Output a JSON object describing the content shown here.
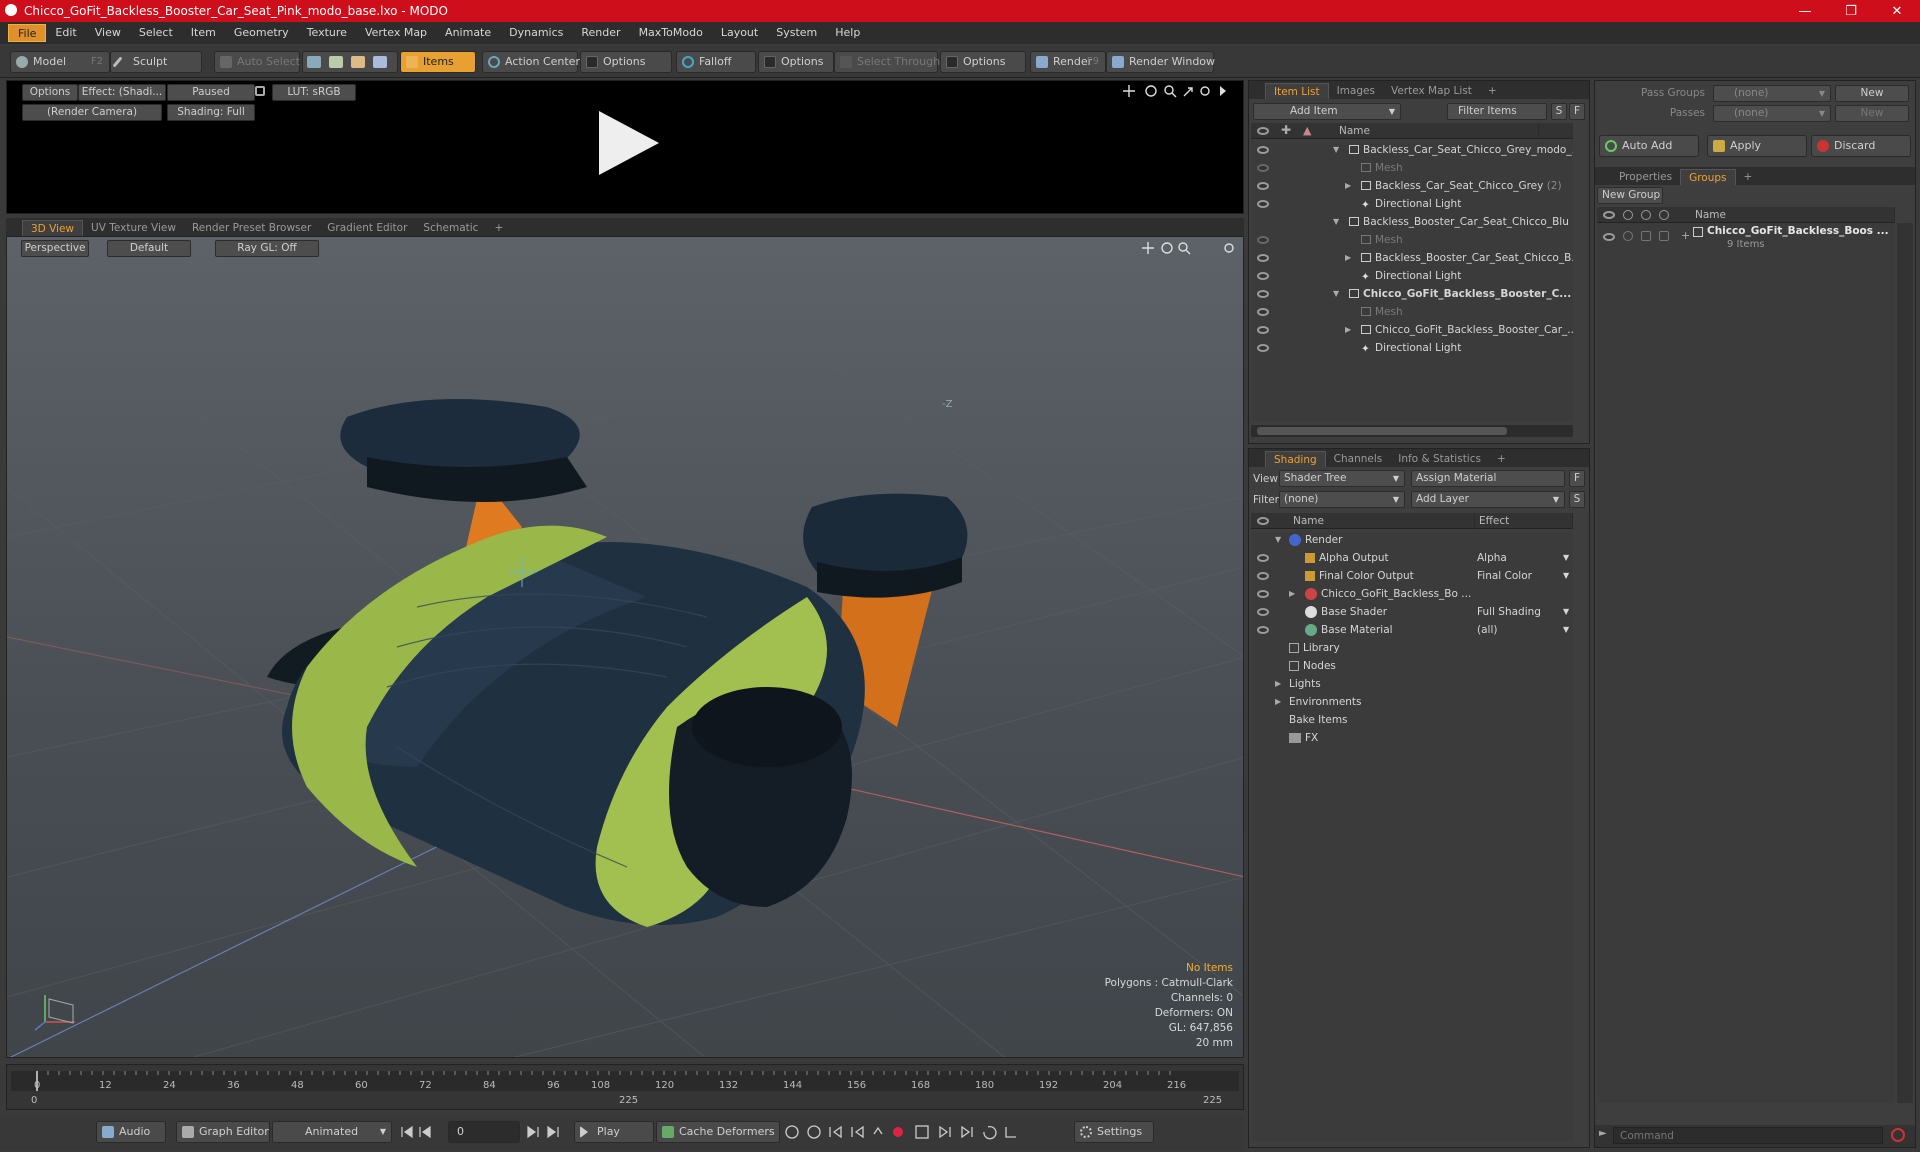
{
  "window": {
    "title": "Chicco_GoFit_Backless_Booster_Car_Seat_Pink_modo_base.lxo - MODO"
  },
  "menu": [
    "File",
    "Edit",
    "View",
    "Select",
    "Item",
    "Geometry",
    "Texture",
    "Vertex Map",
    "Animate",
    "Dynamics",
    "Render",
    "MaxToModo",
    "Layout",
    "System",
    "Help"
  ],
  "toolbar": {
    "model": "Model",
    "model_key": "F2",
    "sculpt": "Sculpt",
    "auto_select": "Auto Select",
    "items": "Items",
    "action_center": "Action Center",
    "options1": "Options",
    "falloff": "Falloff",
    "options2": "Options",
    "select_through": "Select Through",
    "options3": "Options",
    "render": "Render",
    "render_key": "F9",
    "render_window": "Render Window"
  },
  "preview": {
    "options": "Options",
    "effect": "Effect: (Shadi...",
    "paused": "Paused",
    "lut": "LUT: sRGB",
    "camera": "(Render Camera)",
    "shading": "Shading: Full"
  },
  "viewport_tabs": [
    "3D View",
    "UV Texture View",
    "Render Preset Browser",
    "Gradient Editor",
    "Schematic"
  ],
  "viewport": {
    "perspective": "Perspective",
    "default": "Default",
    "raygl": "Ray GL: Off",
    "axis_label": "-Z",
    "info": {
      "no_items": "No Items",
      "polygons": "Polygons : Catmull-Clark",
      "channels": "Channels: 0",
      "deformers": "Deformers: ON",
      "gl": "GL: 647,856",
      "scale": "20 mm"
    }
  },
  "timeline": {
    "ticks": [
      "0",
      "12",
      "24",
      "36",
      "48",
      "60",
      "72",
      "84",
      "96",
      "108",
      "120",
      "132",
      "144",
      "156",
      "168",
      "180",
      "192",
      "204",
      "216"
    ],
    "start": "0",
    "mid": "225",
    "end": "225"
  },
  "bottombar": {
    "audio": "Audio",
    "graph_editor": "Graph Editor",
    "animated": "Animated",
    "frame": "0",
    "play": "Play",
    "cache": "Cache Deformers",
    "settings": "Settings"
  },
  "item_list": {
    "tabs": [
      "Item List",
      "Images",
      "Vertex Map List"
    ],
    "add_item": "Add Item",
    "filter_items": "Filter Items",
    "col_name": "Name",
    "rows": [
      {
        "label": "Backless_Car_Seat_Chicco_Grey_modo_...",
        "indent": 0,
        "dim": false,
        "bold": false
      },
      {
        "label": "Mesh",
        "indent": 1,
        "dim": true,
        "bold": false
      },
      {
        "label": "Backless_Car_Seat_Chicco_Grey",
        "suffix": "(2)",
        "indent": 1,
        "dim": false,
        "bold": false
      },
      {
        "label": "Directional Light",
        "indent": 1,
        "dim": false,
        "bold": false
      },
      {
        "label": "Backless_Booster_Car_Seat_Chicco_Blu ...",
        "indent": 0,
        "dim": false,
        "bold": false
      },
      {
        "label": "Mesh",
        "indent": 1,
        "dim": true,
        "bold": false
      },
      {
        "label": "Backless_Booster_Car_Seat_Chicco_B...",
        "indent": 1,
        "dim": false,
        "bold": false
      },
      {
        "label": "Directional Light",
        "indent": 1,
        "dim": false,
        "bold": false
      },
      {
        "label": "Chicco_GoFit_Backless_Booster_C...",
        "indent": 0,
        "dim": false,
        "bold": true
      },
      {
        "label": "Mesh",
        "indent": 1,
        "dim": true,
        "bold": false
      },
      {
        "label": "Chicco_GoFit_Backless_Booster_Car_...",
        "indent": 1,
        "dim": false,
        "bold": false
      },
      {
        "label": "Directional Light",
        "indent": 1,
        "dim": false,
        "bold": false
      }
    ]
  },
  "shading": {
    "tabs": [
      "Shading",
      "Channels",
      "Info & Statistics"
    ],
    "view_label": "View",
    "view_value": "Shader Tree",
    "assign_material": "Assign Material",
    "filter_label": "Filter",
    "filter_value": "(none)",
    "add_layer": "Add Layer",
    "col_name": "Name",
    "col_effect": "Effect",
    "rows": [
      {
        "label": "Render",
        "effect": ""
      },
      {
        "label": "Alpha Output",
        "effect": "Alpha"
      },
      {
        "label": "Final Color Output",
        "effect": "Final Color"
      },
      {
        "label": "Chicco_GoFit_Backless_Bo ...",
        "effect": ""
      },
      {
        "label": "Base Shader",
        "effect": "Full Shading"
      },
      {
        "label": "Base Material",
        "effect": "(all)"
      },
      {
        "label": "Library",
        "effect": ""
      },
      {
        "label": "Nodes",
        "effect": ""
      },
      {
        "label": "Lights",
        "effect": ""
      },
      {
        "label": "Environments",
        "effect": ""
      },
      {
        "label": "Bake Items",
        "effect": ""
      },
      {
        "label": "FX",
        "effect": ""
      }
    ]
  },
  "groups": {
    "pass_groups": "Pass Groups",
    "passes": "Passes",
    "none1": "(none)",
    "none2": "(none)",
    "new1": "New",
    "new2": "New",
    "auto_add": "Auto Add",
    "apply": "Apply",
    "discard": "Discard",
    "tabs": [
      "Properties",
      "Groups"
    ],
    "new_group": "New Group",
    "col_name": "Name",
    "group_name": "Chicco_GoFit_Backless_Boos ...",
    "group_count": "9 Items",
    "command_placeholder": "Command"
  },
  "colors": {
    "accent": "#e8a030",
    "titlebar": "#cf0e1c",
    "seat_navy": "#1d2c3c",
    "seat_green": "#9ab84a",
    "seat_orange": "#e07a20"
  }
}
